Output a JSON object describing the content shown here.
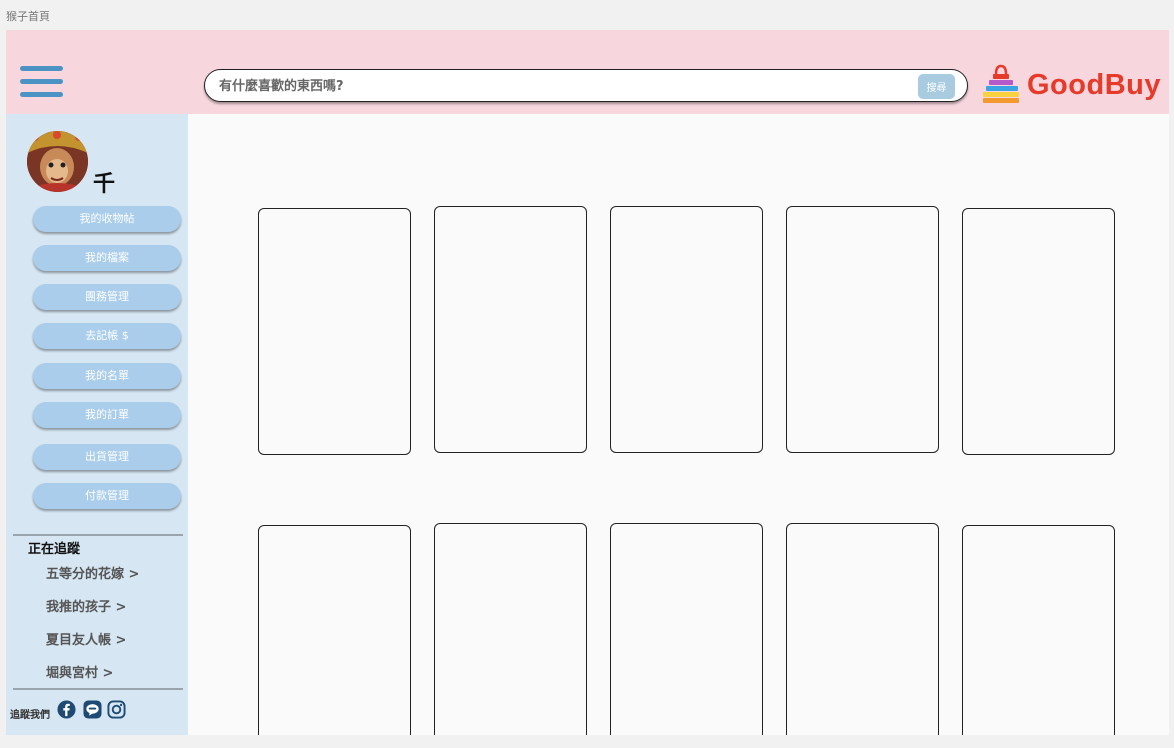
{
  "page": {
    "title": "猴子首頁"
  },
  "header": {
    "search": {
      "placeholder": "有什麼喜歡的東西嗎?",
      "button_label": "搜尋"
    },
    "logo": {
      "text": "GoodBuy",
      "colors": [
        "#e63a2a",
        "#f29a2e",
        "#f7d23e",
        "#3aa3e3",
        "#b558c9"
      ]
    }
  },
  "sidebar": {
    "username": "千",
    "menu": [
      "我的收物帖",
      "我的檔案",
      "團務管理",
      "去記帳 $",
      "我的名單",
      "我的訂單",
      "出貨管理",
      "付款管理"
    ],
    "following": {
      "heading": "正在追蹤",
      "items": [
        "五等分的花嫁 >",
        "我推的孩子 >",
        "夏目友人帳 >",
        "堀與宮村 >"
      ]
    },
    "social": {
      "label": "追蹤我們",
      "icons": [
        "facebook-icon",
        "line-icon",
        "instagram-icon"
      ]
    }
  },
  "colors": {
    "header_bg": "#f7d6de",
    "sidebar_bg": "#d6e6f2",
    "button_blue": "#a9cdeb",
    "accent_blue": "#4a93c3"
  }
}
